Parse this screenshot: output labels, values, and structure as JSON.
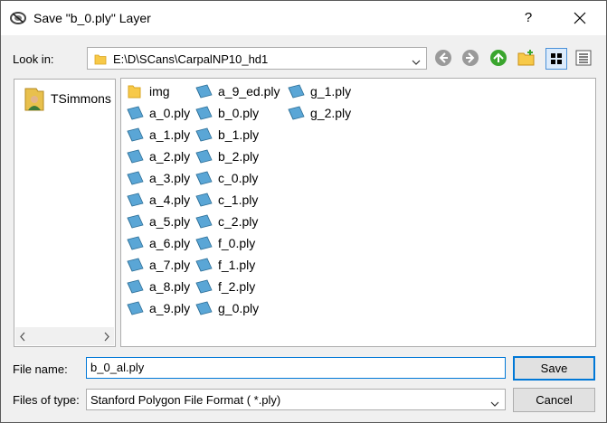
{
  "window": {
    "title": "Save \"b_0.ply\" Layer",
    "help_label": "?"
  },
  "look_in": {
    "label": "Look in:",
    "path": "E:\\D\\SCans\\CarpalNP10_hd1"
  },
  "toolbar": {
    "icons": [
      "back-icon",
      "forward-icon",
      "parent-folder-icon",
      "new-folder-icon",
      "list-view-icon",
      "detail-view-icon"
    ]
  },
  "places": {
    "items": [
      {
        "label": "TSimmons",
        "icon": "user-icon"
      }
    ]
  },
  "files": {
    "columns": [
      [
        "img",
        "a_0.ply",
        "a_1.ply",
        "a_2.ply",
        "a_3.ply",
        "a_4.ply",
        "a_5.ply",
        "a_6.ply",
        "a_7.ply",
        "a_8.ply",
        "a_9.ply"
      ],
      [
        "a_9_ed.ply",
        "b_0.ply",
        "b_1.ply",
        "b_2.ply",
        "c_0.ply",
        "c_1.ply",
        "c_2.ply",
        "f_0.ply",
        "f_1.ply",
        "f_2.ply",
        "g_0.ply"
      ],
      [
        "g_1.ply",
        "g_2.ply"
      ]
    ],
    "folder_names": [
      "img"
    ]
  },
  "file_name": {
    "label": "File name:",
    "value": "b_0_al.ply"
  },
  "file_type": {
    "label": "Files of type:",
    "value": "Stanford Polygon File Format ( *.ply)"
  },
  "buttons": {
    "save": "Save",
    "cancel": "Cancel"
  },
  "colors": {
    "accent": "#0078d7",
    "folder": "#f7c948",
    "file_icon": "#5aa6d6"
  }
}
